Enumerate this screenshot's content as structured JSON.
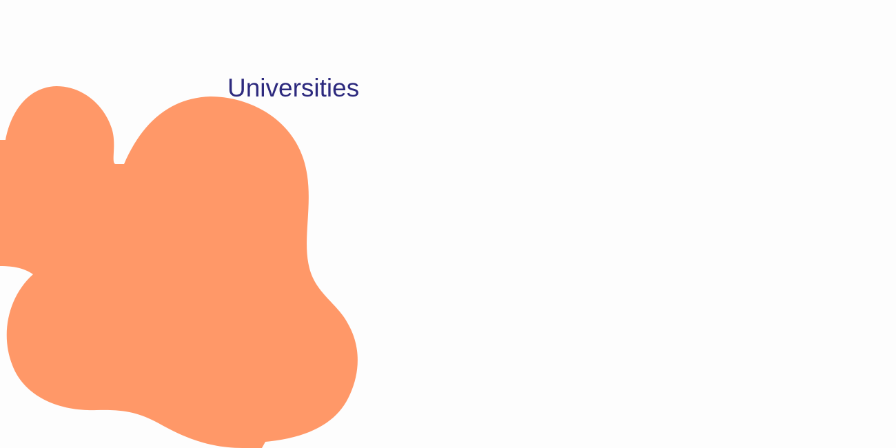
{
  "section": {
    "title": "Universities"
  },
  "colors": {
    "background": "#fdfdfd",
    "blob": "#ff9868",
    "title": "#2d2a7e"
  },
  "decoration": {
    "icon": "organic-blob-shape"
  }
}
